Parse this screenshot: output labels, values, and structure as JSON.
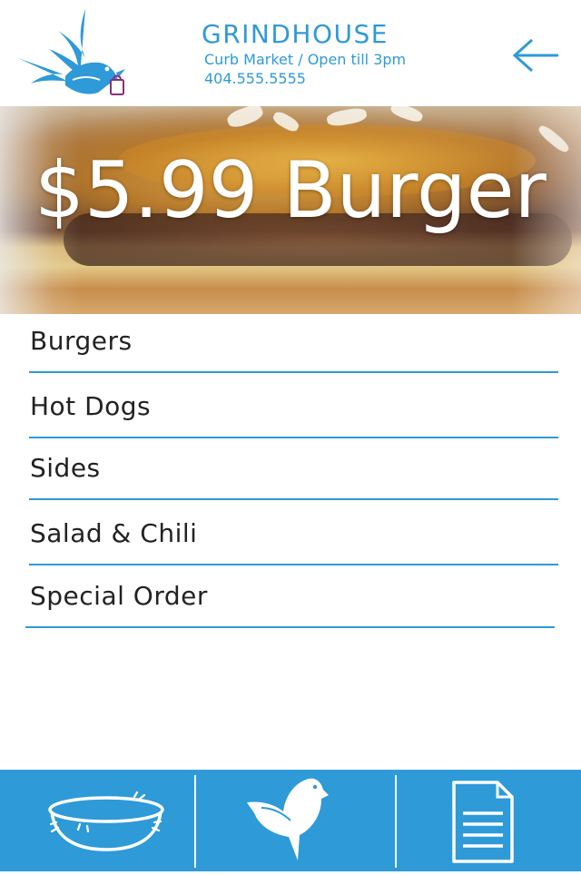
{
  "header": {
    "brand": "GRINDHOUSE",
    "subtitle": "Curb Market / Open till 3pm",
    "phone": "404.555.5555",
    "logo_icon": "swallow-logo-icon",
    "back_icon": "arrow-left-icon"
  },
  "hero": {
    "title": "$5.99 Burger"
  },
  "menu": {
    "items": [
      {
        "label": "Burgers"
      },
      {
        "label": "Hot Dogs"
      },
      {
        "label": "Sides"
      },
      {
        "label": "Salad & Chili"
      },
      {
        "label": "Special Order"
      }
    ]
  },
  "tabbar": {
    "tabs": [
      {
        "icon": "bowl-icon"
      },
      {
        "icon": "bird-icon"
      },
      {
        "icon": "document-icon"
      }
    ]
  },
  "colors": {
    "accent": "#2e9ad8",
    "text": "#222222",
    "background": "#ffffff"
  }
}
